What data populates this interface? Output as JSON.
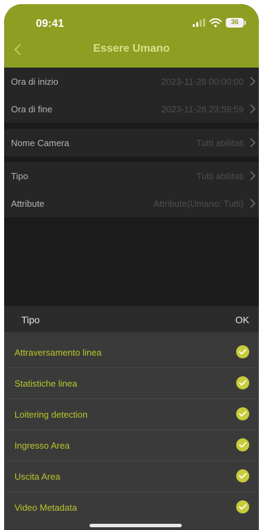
{
  "status_bar": {
    "time": "09:41",
    "battery": "36"
  },
  "nav": {
    "title": "Essere Umano"
  },
  "filters": [
    {
      "label": "Ora di inizio",
      "value": "2023-11-28 00:00:00"
    },
    {
      "label": "Ora di fine",
      "value": "2023-11-28 23:59:59"
    },
    {
      "label": "Nome Camera",
      "value": "Tutti abilitati"
    },
    {
      "label": "Tipo",
      "value": "Tutti abilitati"
    },
    {
      "label": "Attribute",
      "value": "Attribute(Umano: Tutti)"
    }
  ],
  "sheet": {
    "title": "Tipo",
    "ok_label": "OK",
    "options": [
      {
        "label": "Attraversamento linea",
        "checked": true
      },
      {
        "label": "Statistiche linea",
        "checked": true
      },
      {
        "label": "Loitering detection",
        "checked": true
      },
      {
        "label": "Ingresso Area",
        "checked": true
      },
      {
        "label": "Uscita Area",
        "checked": true
      },
      {
        "label": "Video Metadata",
        "checked": true
      }
    ]
  },
  "colors": {
    "accent": "#8e9e22",
    "option_text": "#b9c62a",
    "check": "#c7cc3a"
  }
}
